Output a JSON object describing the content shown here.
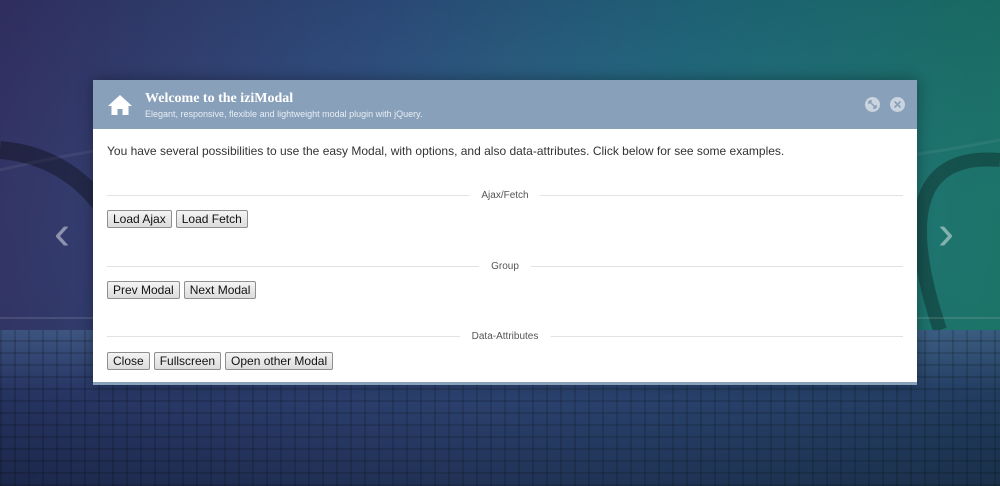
{
  "modal": {
    "title": "Welcome to the iziModal",
    "subtitle": "Elegant, responsive, flexible and lightweight modal plugin with jQuery.",
    "header_icon": "home-icon",
    "header_buttons": [
      "fullscreen-icon",
      "close-icon"
    ],
    "accent_color": "#88a0b9"
  },
  "body": {
    "intro": "You have several possibilities to use the easy Modal, with options, and also data-attributes. Click below for see some examples.",
    "sections": [
      {
        "label": "Ajax/Fetch",
        "buttons": [
          "Load Ajax",
          "Load Fetch"
        ]
      },
      {
        "label": "Group",
        "buttons": [
          "Prev Modal",
          "Next Modal"
        ]
      },
      {
        "label": "Data-Attributes",
        "buttons": [
          "Close",
          "Fullscreen",
          "Open other Modal"
        ]
      }
    ]
  },
  "nav": {
    "prev_icon": "chevron-left-icon",
    "next_icon": "chevron-right-icon"
  }
}
